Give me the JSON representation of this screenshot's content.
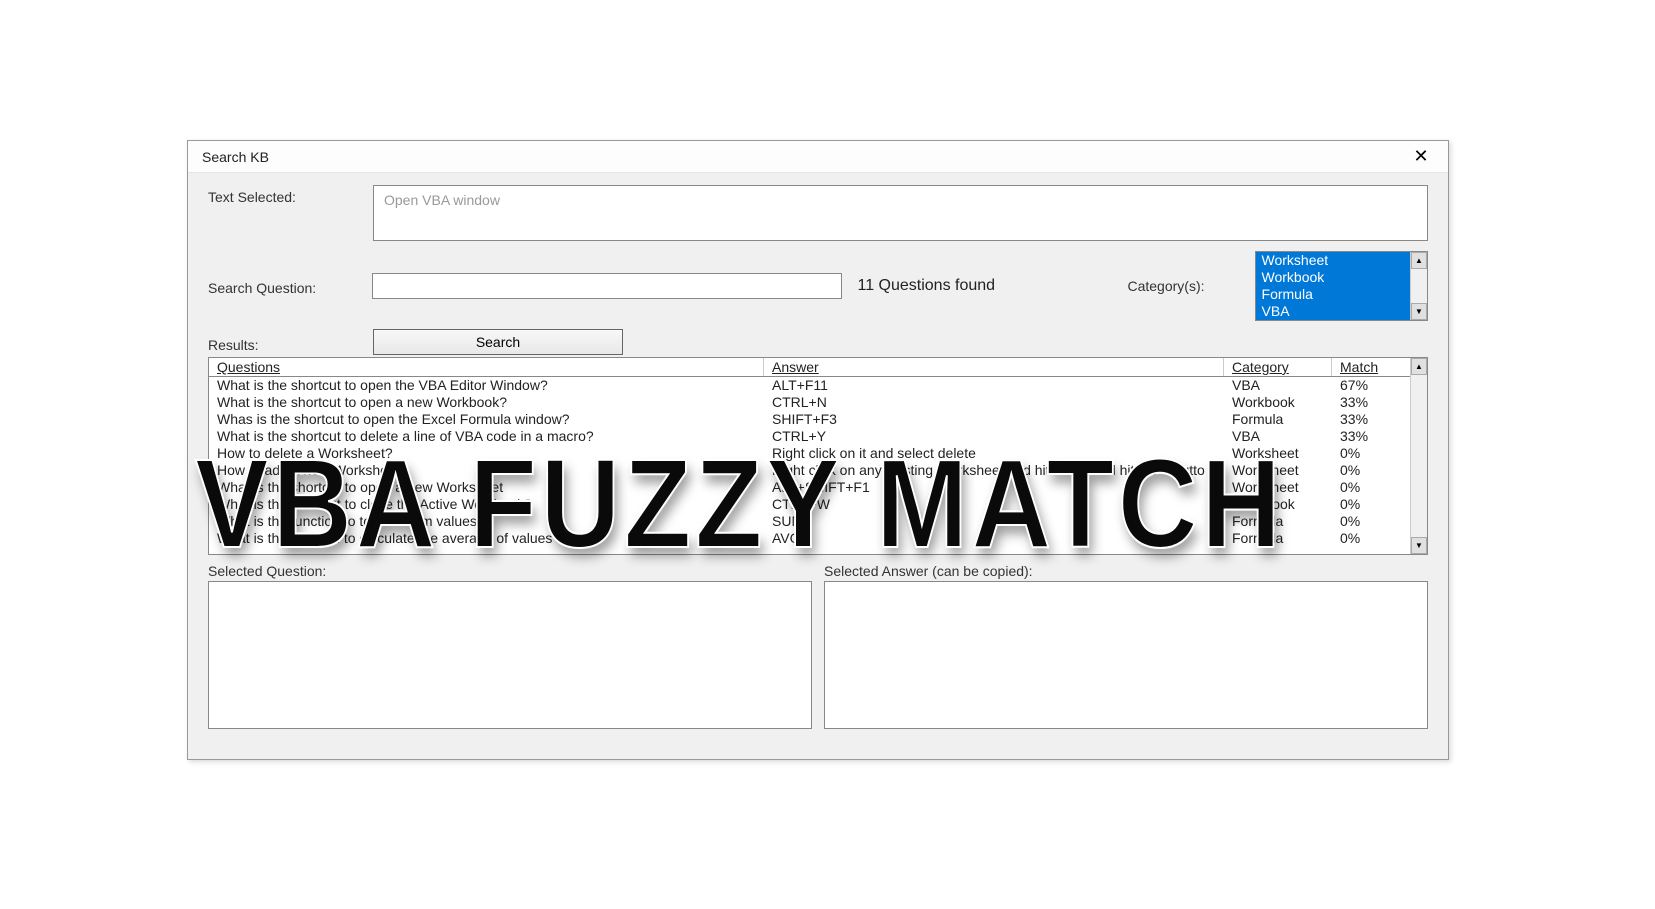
{
  "titlebar": {
    "title": "Search KB",
    "close_glyph": "✕"
  },
  "labels": {
    "text_selected": "Text Selected:",
    "search_question": "Search Question:",
    "category": "Category(s):",
    "results": "Results:",
    "selected_question": "Selected Question:",
    "selected_answer": "Selected Answer (can be copied):"
  },
  "text_selected_value": "Open VBA window",
  "search_button": "Search",
  "found_text": "11 Questions found",
  "categories": [
    "Worksheet",
    "Workbook",
    "Formula",
    "VBA"
  ],
  "grid_headers": {
    "questions": "Questions",
    "answer": "Answer",
    "category": "Category",
    "match": "Match"
  },
  "results_rows": [
    {
      "q": "What is the shortcut to open the VBA Editor Window?",
      "a": "ALT+F11",
      "c": "VBA",
      "m": "67%"
    },
    {
      "q": "What is the shortcut to open a new Workbook?",
      "a": "CTRL+N",
      "c": "Workbook",
      "m": "33%"
    },
    {
      "q": "Whas is the shortcut to open the Excel Formula window?",
      "a": "SHIFT+F3",
      "c": "Formula",
      "m": "33%"
    },
    {
      "q": "What is the shortcut to delete a line of VBA code in a macro?",
      "a": "CTRL+Y",
      "c": "VBA",
      "m": "33%"
    },
    {
      "q": "How to delete a Worksheet?",
      "a": "Right click on it and select delete",
      "c": "Worksheet",
      "m": "0%"
    },
    {
      "q": "How to add a new Worksheet?",
      "a": "Right click on any existing Worksheet and hit Insert and hit the + butto",
      "c": "Worksheet",
      "m": "0%"
    },
    {
      "q": "What is the shortcut to open a new Worksheet",
      "a": "ALT+SHIFT+F1",
      "c": "Worksheet",
      "m": "0%"
    },
    {
      "q": "What is the shortcut to close the Active Workbook?",
      "a": "CTRL+W",
      "c": "Workbook",
      "m": "0%"
    },
    {
      "q": "What is the function to total or sum values?",
      "a": "SUM",
      "c": "Formula",
      "m": "0%"
    },
    {
      "q": "What is the function to calculate the average of values",
      "a": "AVG",
      "c": "Formula",
      "m": "0%"
    }
  ],
  "overlay": "VBA FUZZY MATCH",
  "scroll_up": "▲",
  "scroll_down": "▼"
}
